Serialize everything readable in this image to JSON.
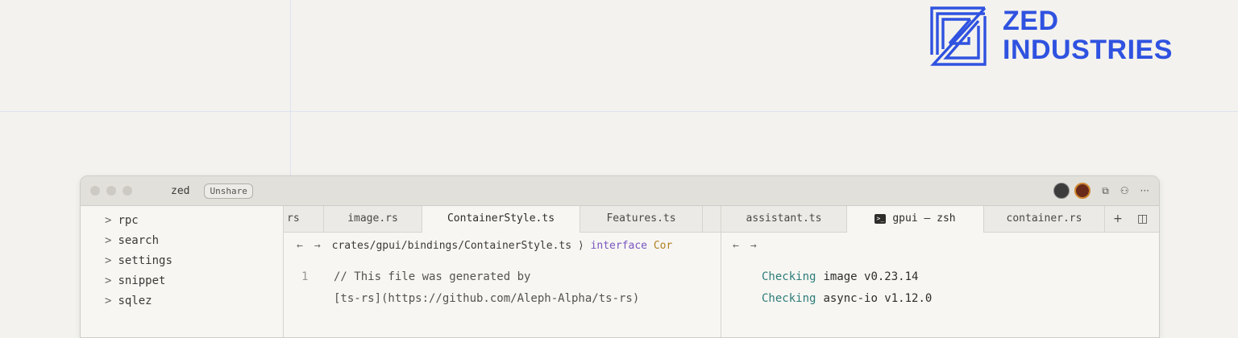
{
  "logo": {
    "line1": "ZED",
    "line2": "INDUSTRIES",
    "color": "#2f52e0"
  },
  "window": {
    "project_name": "zed",
    "unshare_label": "Unshare",
    "toolbar_icons": [
      "screen-share-icon",
      "add-collaborator-icon",
      "more-icon"
    ],
    "toolbar_glyphs": {
      "screen": "⧉",
      "person": "⚇",
      "more": "···"
    }
  },
  "sidebar": {
    "items": [
      {
        "label": "rpc"
      },
      {
        "label": "search"
      },
      {
        "label": "settings"
      },
      {
        "label": "snippet"
      },
      {
        "label": "sqlez"
      }
    ],
    "chevron": ">"
  },
  "left_pane": {
    "tabs": [
      {
        "label": "rs",
        "active": false
      },
      {
        "label": "image.rs",
        "active": false
      },
      {
        "label": "ContainerStyle.ts",
        "active": true
      },
      {
        "label": "Features.ts",
        "active": false
      }
    ],
    "nav_back": "←",
    "nav_forward": "→",
    "breadcrumb_path": "crates/gpui/bindings/ContainerStyle.ts",
    "breadcrumb_sep": "⟩",
    "breadcrumb_kw": "interface",
    "breadcrumb_symbol": "Cor",
    "code": [
      {
        "ln": "1",
        "text": "// This file was generated by"
      },
      {
        "ln": "",
        "text": "[ts-rs](https://github.com/Aleph-Alpha/ts-rs)"
      }
    ]
  },
  "right_pane": {
    "tabs": [
      {
        "label": "assistant.ts",
        "active": false
      },
      {
        "label": "gpui — zsh",
        "active": true
      },
      {
        "label": "container.rs",
        "active": false
      }
    ],
    "add_tab": "+",
    "split_icon": "◫",
    "nav_back": "←",
    "nav_forward": "→",
    "terminal": [
      {
        "kw": "Checking",
        "text": "image v0.23.14"
      },
      {
        "kw": "Checking",
        "text": "async-io v1.12.0"
      }
    ]
  }
}
